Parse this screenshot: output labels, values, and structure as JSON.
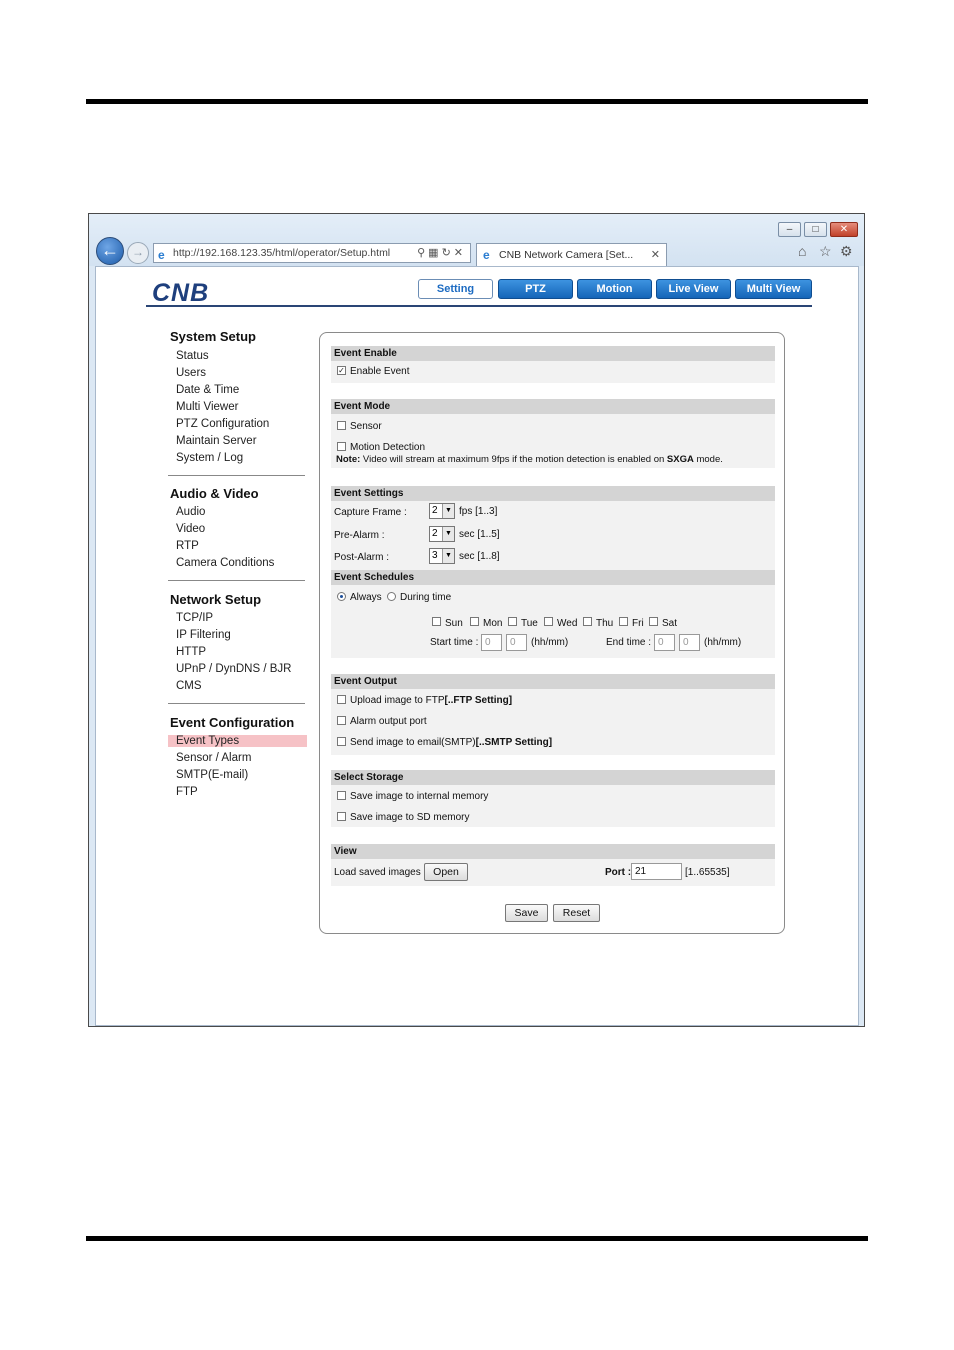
{
  "browser": {
    "address_url": "http://192.168.123.35/html/operator/Setup.html",
    "tab_title": "CNB Network Camera [Set...",
    "window_buttons": {
      "minimize": "–",
      "maximize": "□",
      "close": "✕"
    },
    "icons": [
      "back-arrow-icon",
      "forward-arrow-icon",
      "ie-logo-icon",
      "search-icon",
      "compat-view-icon",
      "refresh-icon",
      "stop-icon",
      "home-icon",
      "favorites-star-icon",
      "tools-gear-icon"
    ]
  },
  "header": {
    "logo": "CNB",
    "nav": [
      "Setting",
      "PTZ",
      "Motion",
      "Live View",
      "Multi View"
    ],
    "active_nav": "Setting",
    "accent_color": "#1565b8"
  },
  "sidebar": {
    "system_setup": {
      "title": "System Setup",
      "items": [
        "Status",
        "Users",
        "Date & Time",
        "Multi Viewer",
        "PTZ Configuration",
        "Maintain Server",
        "System / Log"
      ]
    },
    "audio_video": {
      "title": "Audio & Video",
      "items": [
        "Audio",
        "Video",
        "RTP",
        "Camera Conditions"
      ]
    },
    "network_setup": {
      "title": "Network Setup",
      "items": [
        "TCP/IP",
        "IP Filtering",
        "HTTP",
        "UPnP / DynDNS / BJR",
        "CMS"
      ]
    },
    "event_configuration": {
      "title": "Event Configuration",
      "items": [
        "Event Types",
        "Sensor / Alarm",
        "SMTP(E-mail)",
        "FTP"
      ],
      "selected": "Event Types"
    },
    "selected_color": "#f6c2c6"
  },
  "event_enable": {
    "title": "Event Enable",
    "enable_label": "Enable Event",
    "enabled": true
  },
  "event_mode": {
    "title": "Event Mode",
    "sensor_label": "Sensor",
    "motion_label": "Motion Detection",
    "note_prefix": "Note:",
    "note_text": " Video will stream at maximum 9fps if the motion detection is enabled on ",
    "note_bold": "SXGA",
    "note_suffix": " mode."
  },
  "event_settings": {
    "title": "Event Settings",
    "capture_frame": {
      "label": "Capture Frame :",
      "value": "2",
      "unit": "fps [1..3]"
    },
    "pre_alarm": {
      "label": "Pre-Alarm :",
      "value": "2",
      "unit": "sec [1..5]"
    },
    "post_alarm": {
      "label": "Post-Alarm :",
      "value": "3",
      "unit": "sec [1..8]"
    }
  },
  "event_schedules": {
    "title": "Event Schedules",
    "always_label": "Always",
    "during_label": "During time",
    "selected": "Always",
    "days": [
      "Sun",
      "Mon",
      "Tue",
      "Wed",
      "Thu",
      "Fri",
      "Sat"
    ],
    "start_label": "Start time :",
    "end_label": "End time :",
    "start_hh": "0",
    "start_mm": "0",
    "end_hh": "0",
    "end_mm": "0",
    "hhmm_label": "(hh/mm)"
  },
  "event_output": {
    "title": "Event Output",
    "ftp_label": "Upload image to FTP",
    "ftp_link": "[..FTP Setting]",
    "alarm_label": "Alarm output port",
    "email_label": "Send image to email(SMTP)",
    "email_link": "[..SMTP Setting]"
  },
  "select_storage": {
    "title": "Select Storage",
    "internal_label": "Save image to internal memory",
    "sd_label": "Save image to SD memory"
  },
  "view": {
    "title": "View",
    "load_label": "Load saved images",
    "open_button": "Open",
    "port_label": "Port :",
    "port_value": "21",
    "port_range": "[1..65535]"
  },
  "actions": {
    "save": "Save",
    "reset": "Reset"
  }
}
